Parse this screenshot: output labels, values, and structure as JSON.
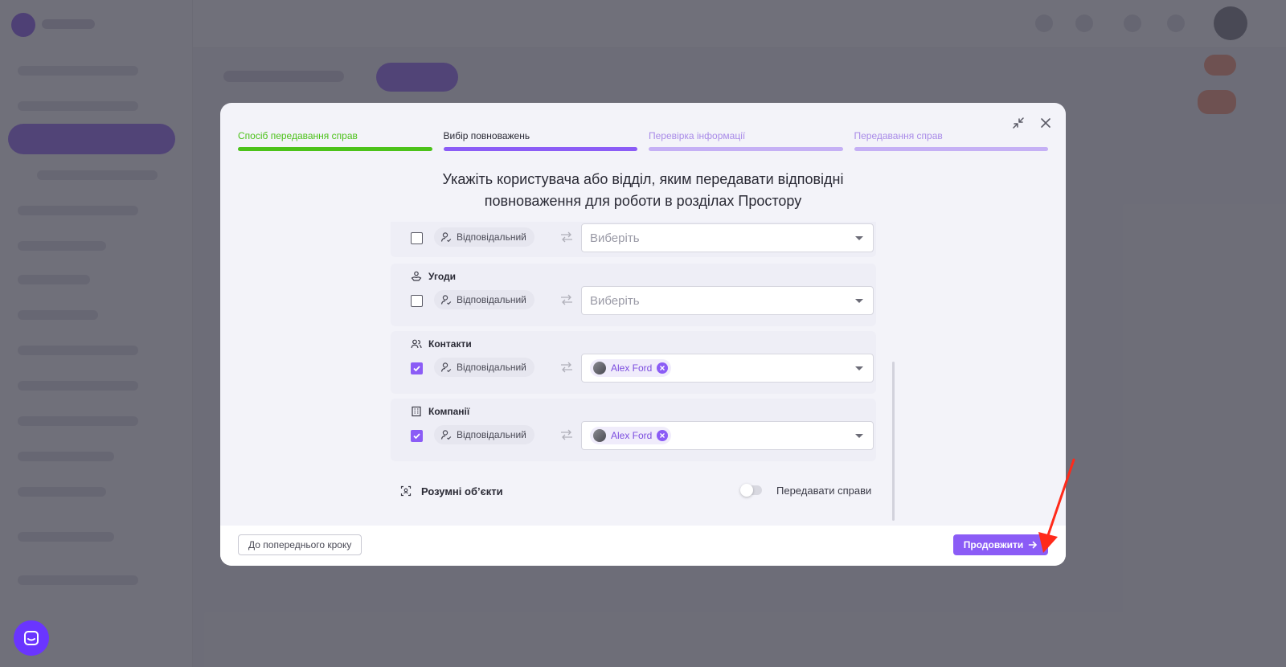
{
  "steps": [
    {
      "label": "Спосіб передавання справ",
      "status": "done",
      "color": "#4cc21a"
    },
    {
      "label": "Вибір повноважень",
      "status": "active",
      "color": "#8b5cf6"
    },
    {
      "label": "Перевірка інформації",
      "status": "pending",
      "color": "#c5b0f5"
    },
    {
      "label": "Передавання справ",
      "status": "pending",
      "color": "#c5b0f5"
    }
  ],
  "title_line1": "Укажіть користувача або відділ, яким передавати відповідні",
  "title_line2": "повноваження для роботи в розділах Простору",
  "sections": [
    {
      "name": "",
      "icon": "none",
      "role": "Відповідальний",
      "checked": false,
      "value": "",
      "placeholder": "Виберіть"
    },
    {
      "name": "Угоди",
      "icon": "handshake-icon",
      "role": "Відповідальний",
      "checked": false,
      "value": "",
      "placeholder": "Виберіть"
    },
    {
      "name": "Контакти",
      "icon": "users-icon",
      "role": "Відповідальний",
      "checked": true,
      "value": "Alex Ford",
      "placeholder": ""
    },
    {
      "name": "Компанії",
      "icon": "building-icon",
      "role": "Відповідальний",
      "checked": true,
      "value": "Alex Ford",
      "placeholder": ""
    }
  ],
  "smart_objects": {
    "label": "Розумні об’єкти",
    "toggle_label": "Передавати справи",
    "toggle_on": false
  },
  "footer": {
    "back_label": "До попереднього кроку",
    "next_label": "Продовжити"
  },
  "colors": {
    "accent": "#8b5cf6",
    "done": "#4cc21a",
    "pending": "#c5b0f5",
    "annotation": "#ff2a1a"
  }
}
